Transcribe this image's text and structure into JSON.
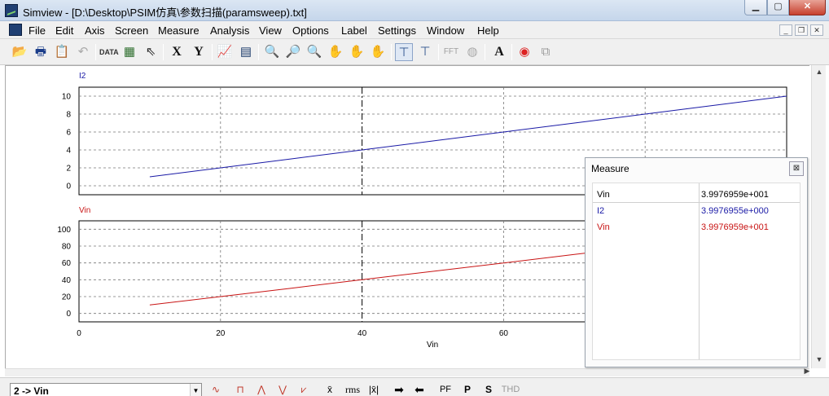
{
  "window": {
    "title": "Simview - [D:\\Desktop\\PSIM仿真\\参数扫描(paramsweep).txt]",
    "min_glyph": "▁",
    "max_glyph": "▢",
    "close_glyph": "✕"
  },
  "menu": {
    "items": [
      "File",
      "Edit",
      "Axis",
      "Screen",
      "Measure",
      "Analysis",
      "View",
      "Options",
      "Label",
      "Settings",
      "Window",
      "Help"
    ],
    "mdi_min": "_",
    "mdi_restore": "❐",
    "mdi_close": "✕"
  },
  "toolbar": {
    "x_label": "X",
    "y_label": "Y",
    "fft_label": "FFT",
    "text_label": "A",
    "icons": [
      "open-icon",
      "print-icon",
      "clipboard-icon",
      "undo-icon",
      "data-icon",
      "properties-icon",
      "select-cursor-icon",
      "x-axis-icon",
      "y-axis-icon",
      "add-curve-icon",
      "screen-icon",
      "zoom-icon",
      "zoom-in-icon",
      "zoom-out-icon",
      "pan-icon",
      "pan-x-icon",
      "pan-y-icon",
      "measure-icon",
      "measure-point-icon",
      "fft-icon",
      "gauge-icon",
      "text-icon",
      "record-icon",
      "copy-screen-icon"
    ]
  },
  "plots": {
    "top": {
      "label": "I2",
      "color": "#1a1aa6",
      "y_ticks": [
        "10",
        "8",
        "6",
        "4",
        "2",
        "0"
      ]
    },
    "bottom": {
      "label": "Vin",
      "color": "#c81414",
      "y_ticks": [
        "100",
        "80",
        "60",
        "40",
        "20",
        "0"
      ]
    },
    "x_ticks": [
      "0",
      "20",
      "40",
      "60"
    ],
    "x_label": "Vin",
    "cursor_x": 40
  },
  "chart_data": [
    {
      "type": "line",
      "title": "",
      "xlabel": "Vin",
      "ylabel": "I2",
      "xlim": [
        0,
        100
      ],
      "ylim": [
        -1,
        11
      ],
      "grid": true,
      "series": [
        {
          "name": "I2",
          "x": [
            10,
            20,
            30,
            40,
            50,
            60,
            70,
            80,
            90,
            100
          ],
          "y": [
            1,
            2,
            3,
            4,
            5,
            6,
            7,
            8,
            9,
            10
          ]
        }
      ]
    },
    {
      "type": "line",
      "title": "",
      "xlabel": "Vin",
      "ylabel": "Vin",
      "xlim": [
        0,
        100
      ],
      "ylim": [
        -10,
        110
      ],
      "grid": true,
      "series": [
        {
          "name": "Vin",
          "x": [
            10,
            20,
            30,
            40,
            50,
            60,
            70,
            80,
            90,
            100
          ],
          "y": [
            10,
            20,
            30,
            40,
            50,
            60,
            70,
            80,
            90,
            100
          ]
        }
      ]
    }
  ],
  "measure": {
    "title": "Measure",
    "close_glyph": "⊠",
    "rows": [
      {
        "name": "Vin",
        "value": "3.9976959e+001",
        "color": "#000000"
      },
      {
        "name": "I2",
        "value": "3.9976955e+000",
        "color": "#1a1aa6"
      },
      {
        "name": "Vin",
        "value": "3.9976959e+001",
        "color": "#c81414"
      }
    ]
  },
  "bottom_bar": {
    "curve_select": "2 -> Vin",
    "buttons": [
      "x̄",
      "rms",
      "|x̄|",
      "➡",
      "⬅",
      "PF",
      "P",
      "S",
      "THD"
    ]
  }
}
